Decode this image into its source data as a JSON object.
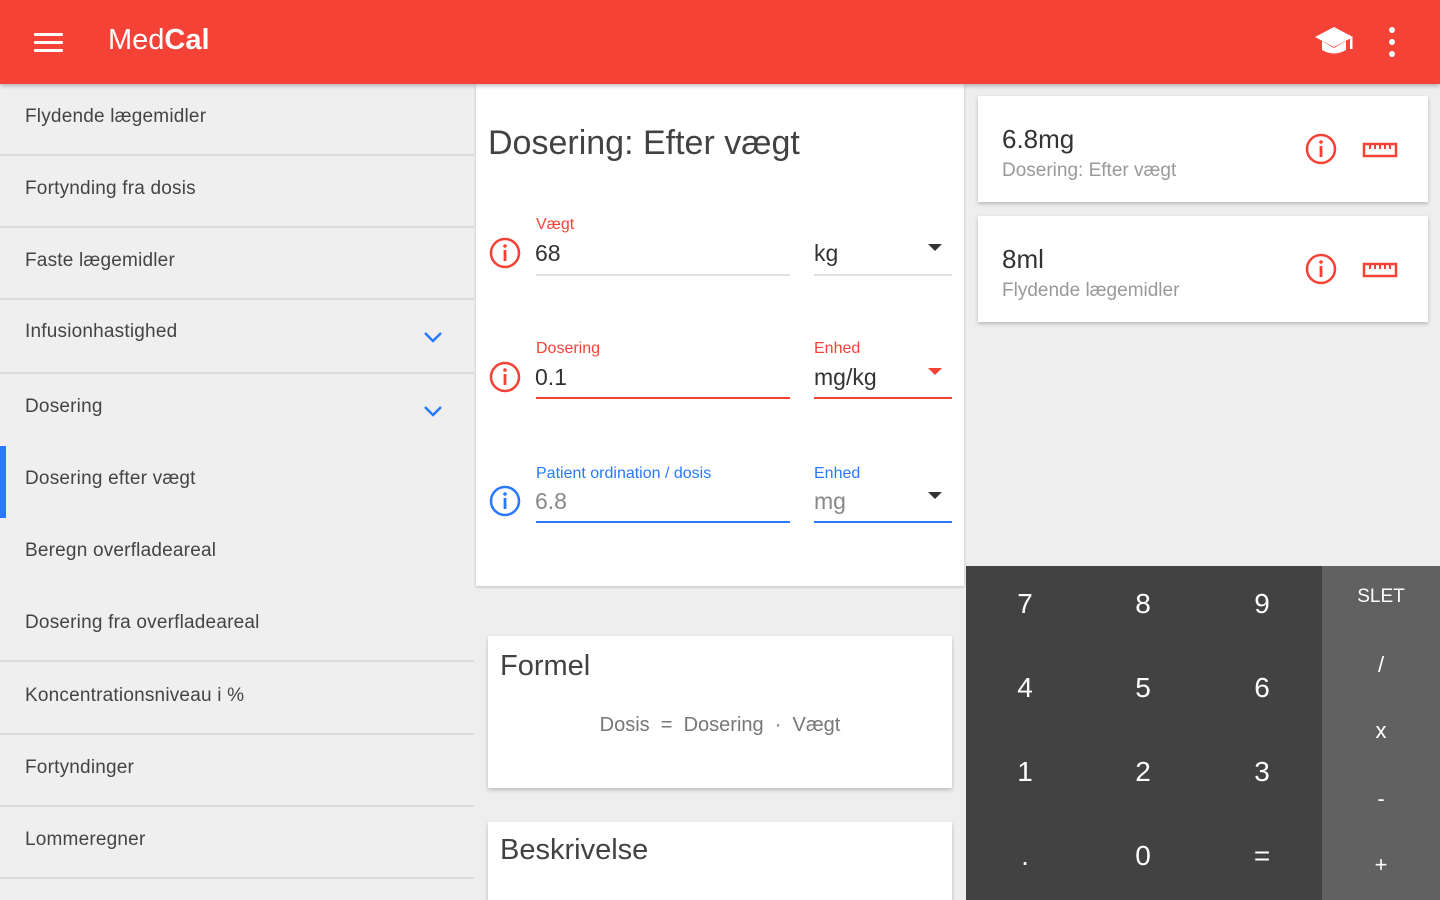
{
  "app": {
    "title_regular": "Med",
    "title_bold": "Cal",
    "theme_color": "#f44336",
    "icons": [
      "menu-icon",
      "school-icon",
      "more-vert-icon"
    ]
  },
  "sidebar": {
    "items": [
      {
        "label": "Flydende lægemidler"
      },
      {
        "label": "Fortynding fra dosis"
      },
      {
        "label": "Faste lægemidler"
      },
      {
        "label": "Infusionhastighed",
        "expandable": true
      },
      {
        "label": "Dosering",
        "expandable": true
      },
      {
        "label": "Dosering efter vægt",
        "active": true
      },
      {
        "label": "Beregn overfladeareal"
      },
      {
        "label": "Dosering fra overfladeareal"
      },
      {
        "label": "Koncentrationsniveau i %"
      },
      {
        "label": "Fortyndinger"
      },
      {
        "label": "Lommeregner"
      }
    ],
    "active_color": "#2979ff"
  },
  "form": {
    "title": "Dosering: Efter vægt",
    "weight": {
      "label": "Vægt",
      "value": "68",
      "unit": "kg"
    },
    "dosage": {
      "label": "Dosering",
      "value": "0.1",
      "unit_label": "Enhed",
      "unit": "mg/kg"
    },
    "result": {
      "label": "Patient ordination / dosis",
      "value": "6.8",
      "unit_label": "Enhed",
      "unit": "mg"
    },
    "colors": {
      "error": "#f44336",
      "focus": "#2979ff"
    }
  },
  "formula": {
    "title": "Formel",
    "text": "Dosis  =  Dosering  ·  Vægt"
  },
  "description": {
    "title": "Beskrivelse"
  },
  "results": [
    {
      "value": "6.8mg",
      "subtitle": "Dosering: Efter vægt"
    },
    {
      "value": "8ml",
      "subtitle": "Flydende lægemidler"
    }
  ],
  "keypad": {
    "keys": [
      "7",
      "8",
      "9",
      "4",
      "5",
      "6",
      "1",
      "2",
      "3",
      ".",
      "0",
      "="
    ],
    "ops": [
      "SLET",
      "/",
      "x",
      "-",
      "+"
    ]
  }
}
